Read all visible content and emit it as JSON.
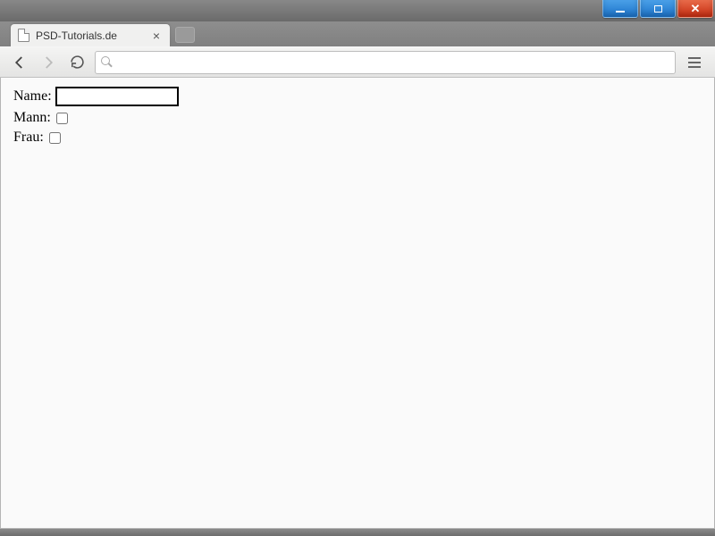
{
  "tab": {
    "title": "PSD-Tutorials.de"
  },
  "toolbar": {
    "omnibox_value": ""
  },
  "form": {
    "name_label": "Name:",
    "name_value": "",
    "mann_label": "Mann:",
    "mann_checked": false,
    "frau_label": "Frau:",
    "frau_checked": false
  }
}
